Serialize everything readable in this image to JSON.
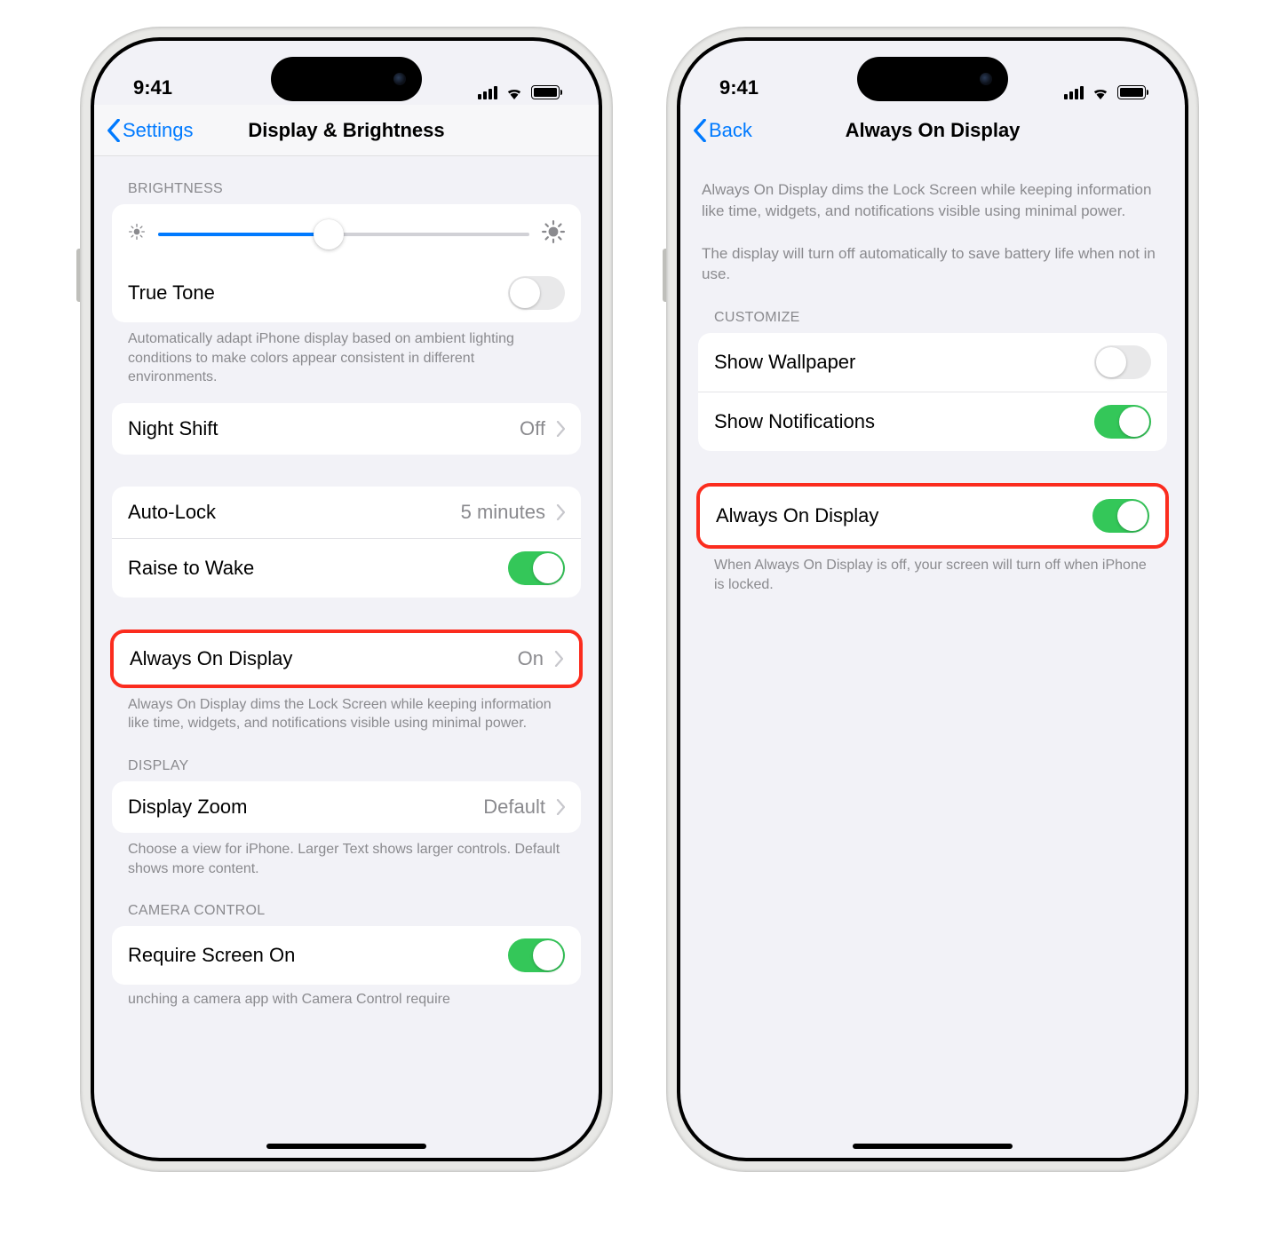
{
  "status": {
    "time": "9:41"
  },
  "left": {
    "back_label": "Settings",
    "title": "Display & Brightness",
    "brightness_header": "BRIGHTNESS",
    "brightness_percent": 46,
    "true_tone_label": "True Tone",
    "true_tone_on": false,
    "true_tone_footer": "Automatically adapt iPhone display based on ambient lighting conditions to make colors appear consistent in different environments.",
    "night_shift_label": "Night Shift",
    "night_shift_value": "Off",
    "auto_lock_label": "Auto-Lock",
    "auto_lock_value": "5 minutes",
    "raise_to_wake_label": "Raise to Wake",
    "raise_to_wake_on": true,
    "aod_label": "Always On Display",
    "aod_value": "On",
    "aod_footer": "Always On Display dims the Lock Screen while keeping information like time, widgets, and notifications visible using minimal power.",
    "display_header": "DISPLAY",
    "display_zoom_label": "Display Zoom",
    "display_zoom_value": "Default",
    "display_zoom_footer": "Choose a view for iPhone. Larger Text shows larger controls. Default shows more content.",
    "camera_header": "CAMERA CONTROL",
    "require_screen_label": "Require Screen On",
    "require_screen_on": true,
    "cut_off_text": "unching a camera app with Camera Control require"
  },
  "right": {
    "back_label": "Back",
    "title": "Always On Display",
    "intro1": "Always On Display dims the Lock Screen while keeping information like time, widgets, and notifications visible using minimal power.",
    "intro2": "The display will turn off automatically to save battery life when not in use.",
    "customize_header": "CUSTOMIZE",
    "show_wallpaper_label": "Show Wallpaper",
    "show_wallpaper_on": false,
    "show_notifications_label": "Show Notifications",
    "show_notifications_on": true,
    "aod_toggle_label": "Always On Display",
    "aod_toggle_on": true,
    "aod_toggle_footer": "When Always On Display is off, your screen will turn off when iPhone is locked."
  }
}
